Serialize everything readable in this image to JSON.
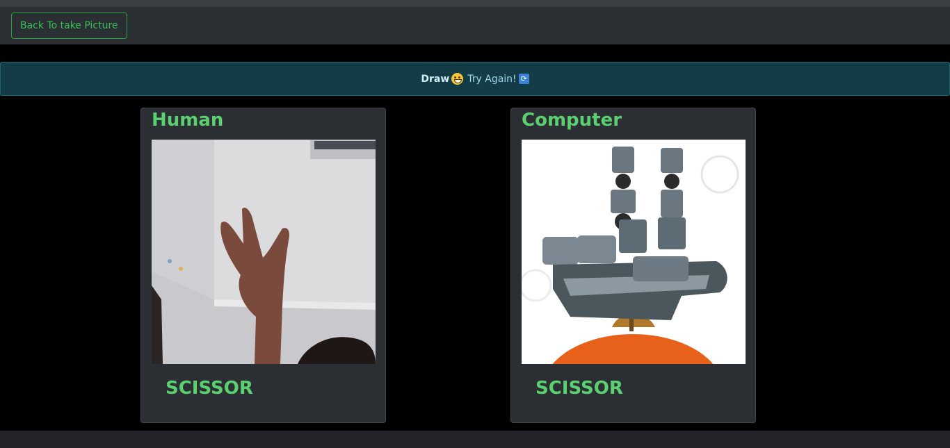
{
  "navbar": {
    "back_label": "Back To take Picture"
  },
  "alert": {
    "result": "Draw",
    "message": "Try Again!",
    "icons": [
      "grinning-face-icon",
      "repeat-icon"
    ]
  },
  "human": {
    "title": "Human",
    "choice": "SCISSOR"
  },
  "computer": {
    "title": "Computer",
    "choice": "SCISSOR"
  },
  "colors": {
    "accent": "#5bd070",
    "alert_bg": "#143c47",
    "navbar_bg": "#2b2e32"
  }
}
